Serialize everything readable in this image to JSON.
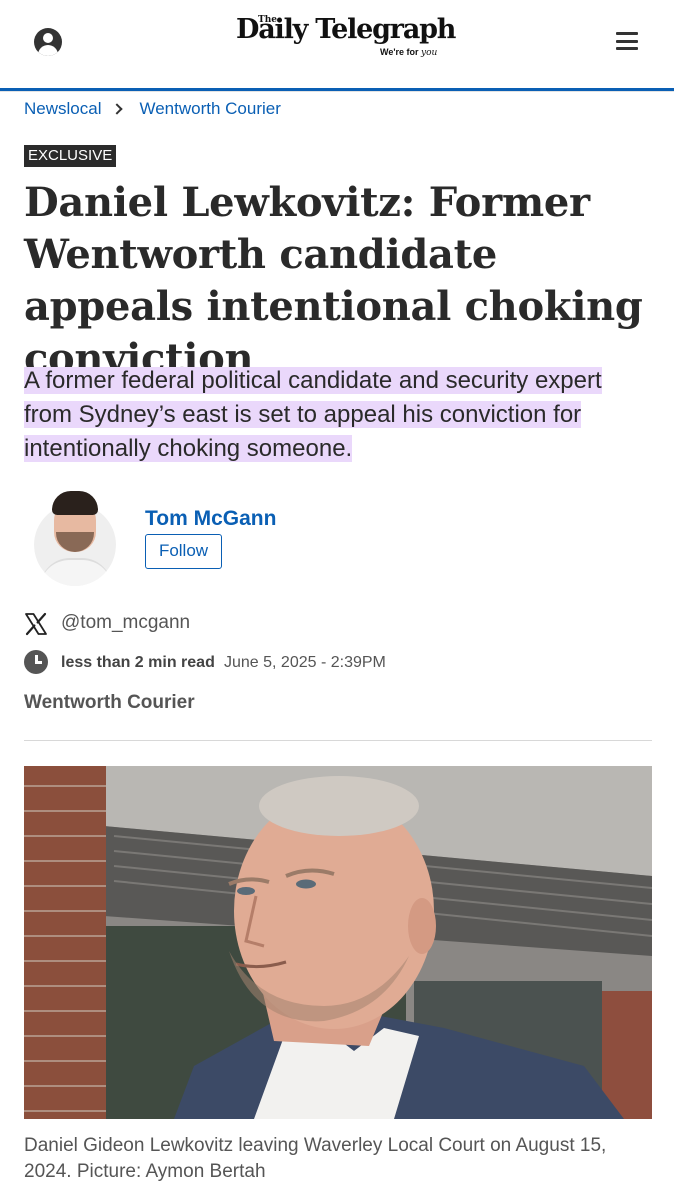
{
  "header": {
    "logo_the": "The",
    "logo_name": "Daily Telegraph",
    "logo_tagline_prefix": "We're for",
    "logo_tagline_you": "you",
    "account_icon": "user-circle-icon",
    "menu_icon": "hamburger-menu-icon",
    "accent_color": "#0a5fb4"
  },
  "breadcrumb": {
    "items": [
      "Newslocal",
      "Wentworth Courier"
    ],
    "separator_icon": "chevron-right-icon"
  },
  "article": {
    "badge": "EXCLUSIVE",
    "headline": "Daniel Lewkovitz: Former Wentworth candidate appeals intentional choking conviction",
    "standfirst": "A former federal political candidate and security expert from Sydney’s east is set to appeal his conviction for intentionally choking someone.",
    "highlight_color": "#ead8fb"
  },
  "author": {
    "name": "Tom McGann",
    "follow_label": "Follow",
    "x_handle": "@tom_mcgann",
    "x_icon": "x-logo-icon"
  },
  "meta": {
    "read_time": "less than 2 min read",
    "date": "June 5, 2025 - 2:39PM",
    "clock_icon": "clock-icon",
    "section": "Wentworth Courier"
  },
  "hero": {
    "caption": "Daniel Gideon Lewkovitz leaving Waverley Local Court on August 15, 2024. Picture: Aymon Bertah"
  }
}
